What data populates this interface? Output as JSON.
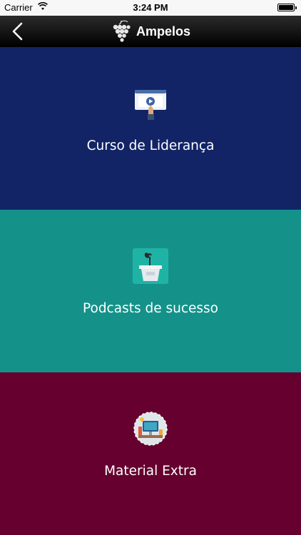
{
  "status_bar": {
    "carrier": "Carrier",
    "time": "3:24 PM",
    "battery_level": 1.0
  },
  "nav_bar": {
    "title": "Ampelos",
    "back_icon": "chevron-left-icon",
    "logo_icon": "grape-cluster-icon"
  },
  "menu": {
    "items": [
      {
        "label": "Curso de Liderança",
        "icon": "video-presentation-icon",
        "color": "#122466"
      },
      {
        "label": "Podcasts de sucesso",
        "icon": "podium-microphone-icon",
        "color": "#14928a"
      },
      {
        "label": "Material Extra",
        "icon": "desk-computer-icon",
        "color": "#65002f"
      }
    ]
  }
}
